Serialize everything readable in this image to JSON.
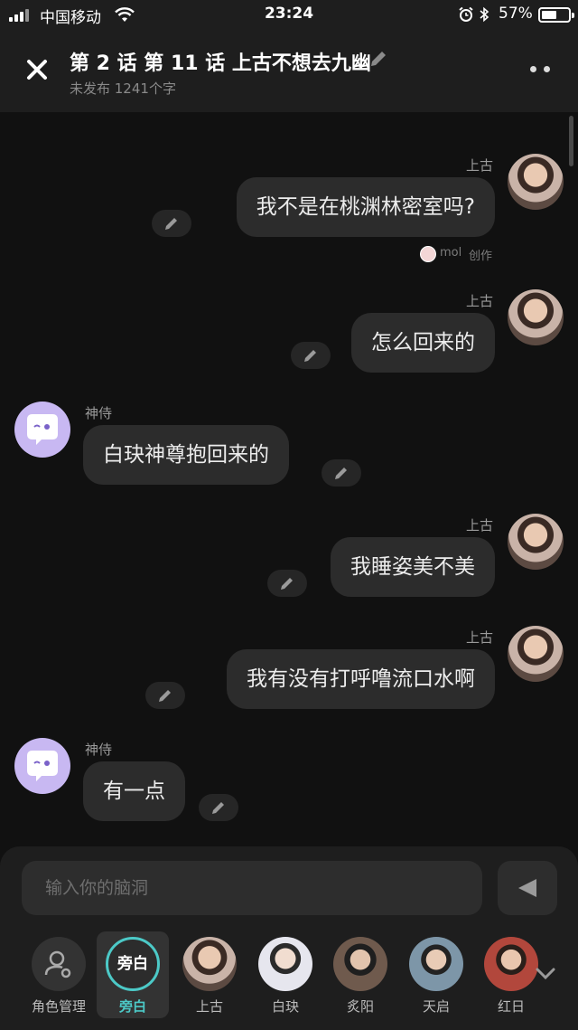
{
  "status_bar": {
    "carrier": "中国移动",
    "time": "23:24",
    "battery": "57%",
    "battery_level": 0.57
  },
  "header": {
    "title": "第 2 话 第 11 话 上古不想去九幽",
    "subtitle": "未发布 1241个字"
  },
  "messages": [
    {
      "side": "right",
      "speaker": "上古",
      "text": "我不是在桃渊林密室吗?",
      "credit_user": "mol",
      "credit_label": "创作"
    },
    {
      "side": "right",
      "speaker": "上古",
      "text": "怎么回来的"
    },
    {
      "side": "left",
      "speaker": "神侍",
      "text": "白玦神尊抱回来的"
    },
    {
      "side": "right",
      "speaker": "上古",
      "text": "我睡姿美不美"
    },
    {
      "side": "right",
      "speaker": "上古",
      "text": "我有没有打呼噜流口水啊"
    },
    {
      "side": "left",
      "speaker": "神侍",
      "text": "有一点"
    }
  ],
  "input": {
    "placeholder": "输入你的脑洞"
  },
  "characters": {
    "manage_label": "角色管理",
    "selected_inner": "旁白",
    "items": [
      "旁白",
      "上古",
      "白玦",
      "炙阳",
      "天启",
      "红日"
    ]
  },
  "icons": {
    "close": "close-icon",
    "edit": "pencil-icon",
    "more": "more-dots-icon",
    "send": "send-icon",
    "expand": "chevron-down-icon",
    "manage": "person-gear-icon"
  },
  "colors": {
    "accent": "#4cc9c7",
    "bubble": "#2c2c2c",
    "background": "#111111"
  }
}
